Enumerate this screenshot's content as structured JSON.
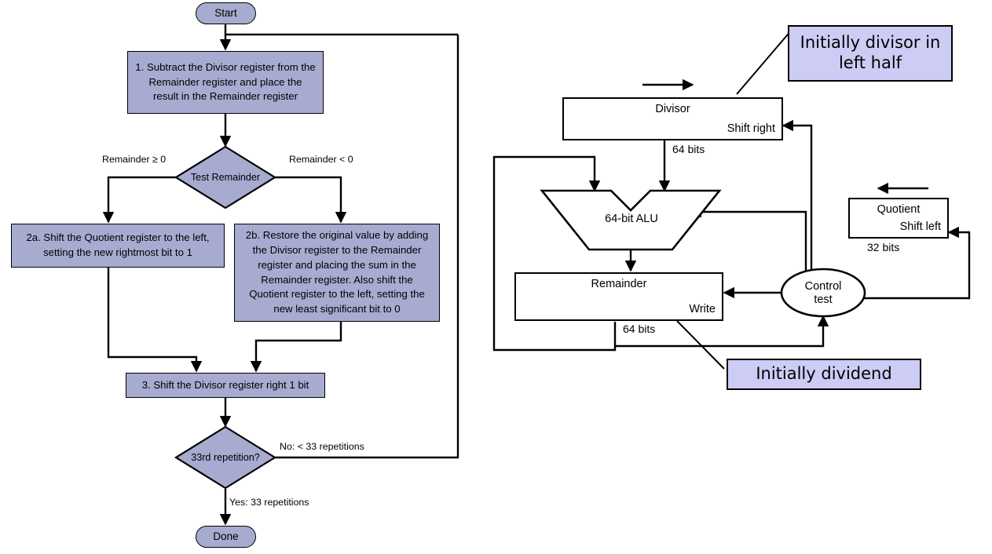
{
  "figure": {
    "left_diagram_name": "division-algorithm-flowchart",
    "right_diagram_name": "division-hardware-datapath"
  },
  "colors": {
    "flowchart_fill": "#a7abd0",
    "callout_fill": "#ccccf5",
    "stroke": "#000000",
    "register_fill": "#ffffff",
    "background": "#ffffff"
  },
  "flowchart": {
    "start": "Start",
    "done": "Done",
    "step1": {
      "lines": [
        "1.  Subtract the Divisor register from the",
        "Remainder register and place the",
        "result in the Remainder register"
      ]
    },
    "test_remainder": "Test Remainder",
    "branch_left_label": "Remainder ≥ 0",
    "branch_right_label": "Remainder < 0",
    "step2a": {
      "lines": [
        "2a.  Shift the Quotient register to the left,",
        "setting the new rightmost bit to 1"
      ]
    },
    "step2b": {
      "lines": [
        "2b.  Restore the original value by adding",
        "the Divisor register to the Remainder",
        "register and placing the sum in the",
        "Remainder register. Also shift the",
        "Quotient register to the left, setting the",
        "new least significant bit to 0"
      ]
    },
    "step3": "3.  Shift the Divisor register right 1 bit",
    "repetition_test": "33rd repetition?",
    "no_label": "No: < 33 repetitions",
    "yes_label": "Yes: 33 repetitions"
  },
  "datapath": {
    "divisor": {
      "title": "Divisor",
      "control": "Shift right",
      "bits": "64 bits"
    },
    "alu": {
      "label": "64-bit ALU"
    },
    "remainder": {
      "title": "Remainder",
      "control": "Write",
      "bits": "64 bits"
    },
    "quotient": {
      "title": "Quotient",
      "control": "Shift left",
      "bits": "32 bits"
    },
    "control": {
      "line1": "Control",
      "line2": "test"
    },
    "callouts": [
      {
        "name": "callout-initially-divisor",
        "lines": [
          "Initially divisor in",
          "left half"
        ]
      },
      {
        "name": "callout-initially-dividend",
        "lines": [
          "Initially dividend"
        ]
      }
    ]
  }
}
